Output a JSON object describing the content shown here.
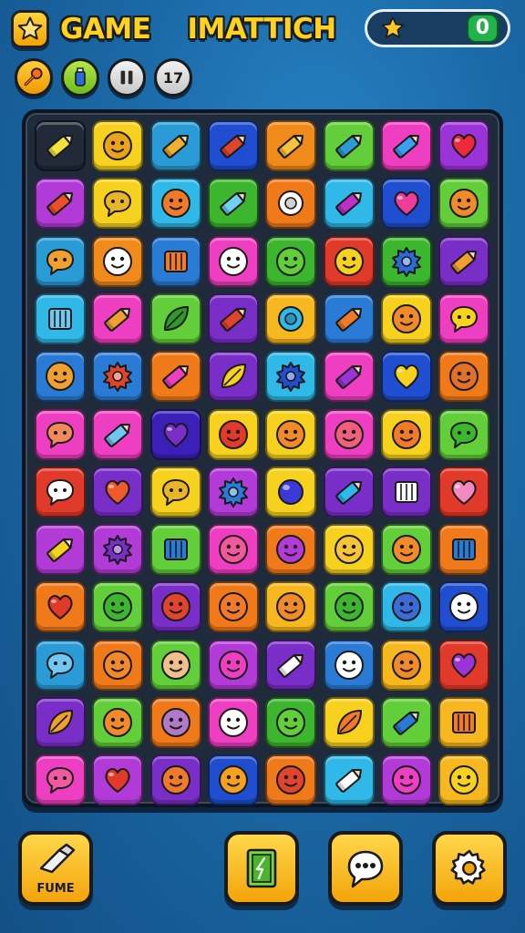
{
  "header": {
    "title_word1": "GAME",
    "title_word2": "IMATTICH",
    "score_value": "0",
    "moves_label": "17"
  },
  "colors": {
    "accent_yellow": "#ffd21f",
    "score_green": "#21b24a",
    "board_bg": "#1f2a3a"
  },
  "toolbar": {
    "buttons": [
      {
        "icon": "key-icon"
      },
      {
        "icon": "bottle-icon"
      },
      {
        "icon": "pause-icon"
      },
      {
        "icon": "moves-counter"
      }
    ]
  },
  "board": {
    "columns": 8,
    "rows": 12,
    "tiles": [
      [
        {
          "c": "#222a3a",
          "i": "pencil",
          "ic": "#f2e23a"
        },
        {
          "c": "#f6d11e",
          "i": "face",
          "ic": "#e9a41c"
        },
        {
          "c": "#2a9bd6",
          "i": "pencil",
          "ic": "#f0b030"
        },
        {
          "c": "#1f4fd0",
          "i": "pencil",
          "ic": "#e0442c"
        },
        {
          "c": "#f08a1a",
          "i": "pencil",
          "ic": "#f6c43a"
        },
        {
          "c": "#62cf3a",
          "i": "pencil",
          "ic": "#2a9bd6"
        },
        {
          "c": "#ee3fc2",
          "i": "pencil",
          "ic": "#3aa0f0"
        },
        {
          "c": "#9a34d8",
          "i": "heart",
          "ic": "#ee2a3a"
        }
      ],
      [
        {
          "c": "#b23bd8",
          "i": "pencil",
          "ic": "#ee4e2a"
        },
        {
          "c": "#f6d11e",
          "i": "bubble",
          "ic": "#e8b42a"
        },
        {
          "c": "#2fb8e8",
          "i": "face",
          "ic": "#f07a2a"
        },
        {
          "c": "#3cb62e",
          "i": "pencil",
          "ic": "#70d0f0"
        },
        {
          "c": "#f07a1a",
          "i": "ring",
          "ic": "#ffffff"
        },
        {
          "c": "#2fb8e8",
          "i": "pencil",
          "ic": "#c030c8"
        },
        {
          "c": "#1f4fd0",
          "i": "heart",
          "ic": "#ee3c9a"
        },
        {
          "c": "#62cf3a",
          "i": "face",
          "ic": "#f08a2a"
        }
      ],
      [
        {
          "c": "#2a9bd6",
          "i": "bubble",
          "ic": "#f0a030"
        },
        {
          "c": "#f08a1a",
          "i": "face",
          "ic": "#ffffff"
        },
        {
          "c": "#2a7bd6",
          "i": "box",
          "ic": "#f07a2a"
        },
        {
          "c": "#ee3fc2",
          "i": "face",
          "ic": "#ffffff"
        },
        {
          "c": "#3cb62e",
          "i": "face",
          "ic": "#62cf3a"
        },
        {
          "c": "#e23a2a",
          "i": "face",
          "ic": "#f6d11e"
        },
        {
          "c": "#3cb62e",
          "i": "gear",
          "ic": "#2a6bd6"
        },
        {
          "c": "#7a2ec8",
          "i": "pencil",
          "ic": "#f0a030"
        }
      ],
      [
        {
          "c": "#2fb8e8",
          "i": "box",
          "ic": "#70c8f0"
        },
        {
          "c": "#ee3fc2",
          "i": "pencil",
          "ic": "#f0a030"
        },
        {
          "c": "#62cf3a",
          "i": "leaf",
          "ic": "#2f9a2a"
        },
        {
          "c": "#7a2ec8",
          "i": "pencil",
          "ic": "#e0442c"
        },
        {
          "c": "#f6b81e",
          "i": "ring",
          "ic": "#2fb8e8"
        },
        {
          "c": "#2a7bd6",
          "i": "pencil",
          "ic": "#f07a2a"
        },
        {
          "c": "#f6d11e",
          "i": "face",
          "ic": "#f08a2a"
        },
        {
          "c": "#ee3fc2",
          "i": "bubble",
          "ic": "#f6d11e"
        }
      ],
      [
        {
          "c": "#2a7bd6",
          "i": "face",
          "ic": "#f0a030"
        },
        {
          "c": "#2a7bd6",
          "i": "gear",
          "ic": "#e0442c"
        },
        {
          "c": "#f07a1a",
          "i": "pencil",
          "ic": "#ee3fc2"
        },
        {
          "c": "#7a2ec8",
          "i": "leaf",
          "ic": "#f6d11e"
        },
        {
          "c": "#2fb8e8",
          "i": "gear",
          "ic": "#1f4fd0"
        },
        {
          "c": "#ee3fc2",
          "i": "pencil",
          "ic": "#9a34d8"
        },
        {
          "c": "#1f4fd0",
          "i": "heart",
          "ic": "#f6d11e"
        },
        {
          "c": "#f07a1a",
          "i": "face",
          "ic": "#e0702a"
        }
      ],
      [
        {
          "c": "#ee3fc2",
          "i": "bubble",
          "ic": "#f08a5a"
        },
        {
          "c": "#ee3fc2",
          "i": "pencil",
          "ic": "#70c8f0"
        },
        {
          "c": "#3a1fb8",
          "i": "heart",
          "ic": "#7a2ec8"
        },
        {
          "c": "#f6d11e",
          "i": "face",
          "ic": "#e23a2a"
        },
        {
          "c": "#f6d11e",
          "i": "face",
          "ic": "#f08a2a"
        },
        {
          "c": "#ee3fc2",
          "i": "face",
          "ic": "#f0607a"
        },
        {
          "c": "#f6d11e",
          "i": "face",
          "ic": "#f07a2a"
        },
        {
          "c": "#62cf3a",
          "i": "bubble",
          "ic": "#3cb62e"
        }
      ],
      [
        {
          "c": "#e23a2a",
          "i": "bubble",
          "ic": "#ffffff"
        },
        {
          "c": "#7a2ec8",
          "i": "heart",
          "ic": "#ee5a2a"
        },
        {
          "c": "#f6d11e",
          "i": "bubble",
          "ic": "#e8b42a"
        },
        {
          "c": "#b23bd8",
          "i": "gear",
          "ic": "#2a7bd6"
        },
        {
          "c": "#f6d11e",
          "i": "ball",
          "ic": "#3a3ad8"
        },
        {
          "c": "#7a2ec8",
          "i": "pencil",
          "ic": "#2fb8e8"
        },
        {
          "c": "#7a2ec8",
          "i": "box",
          "ic": "#ffffff"
        },
        {
          "c": "#e23a2a",
          "i": "heart",
          "ic": "#f08ac0"
        }
      ],
      [
        {
          "c": "#b23bd8",
          "i": "pencil",
          "ic": "#f6d11e"
        },
        {
          "c": "#b23bd8",
          "i": "gear",
          "ic": "#7a2ec8"
        },
        {
          "c": "#62cf3a",
          "i": "box",
          "ic": "#2a7bd6"
        },
        {
          "c": "#ee3fc2",
          "i": "face",
          "ic": "#f05a9a"
        },
        {
          "c": "#f07a1a",
          "i": "face",
          "ic": "#b23bd8"
        },
        {
          "c": "#f6d11e",
          "i": "face",
          "ic": "#f6c43a"
        },
        {
          "c": "#62cf3a",
          "i": "face",
          "ic": "#f08a2a"
        },
        {
          "c": "#f07a1a",
          "i": "box",
          "ic": "#2a7bd6"
        }
      ],
      [
        {
          "c": "#f07a1a",
          "i": "heart",
          "ic": "#e23a2a"
        },
        {
          "c": "#62cf3a",
          "i": "face",
          "ic": "#3cb62e"
        },
        {
          "c": "#7a2ec8",
          "i": "face",
          "ic": "#e0442c"
        },
        {
          "c": "#f07a1a",
          "i": "face",
          "ic": "#f07a2a"
        },
        {
          "c": "#f6b81e",
          "i": "face",
          "ic": "#f08a2a"
        },
        {
          "c": "#62cf3a",
          "i": "face",
          "ic": "#3cb62e"
        },
        {
          "c": "#2fb8e8",
          "i": "face",
          "ic": "#3a6bd6"
        },
        {
          "c": "#1f4fd0",
          "i": "face",
          "ic": "#ffffff"
        }
      ],
      [
        {
          "c": "#2a9bd6",
          "i": "bubble",
          "ic": "#70c8f0"
        },
        {
          "c": "#f07a1a",
          "i": "face",
          "ic": "#f08a2a"
        },
        {
          "c": "#62cf3a",
          "i": "face",
          "ic": "#f0c08a"
        },
        {
          "c": "#b23bd8",
          "i": "face",
          "ic": "#ee3fc2"
        },
        {
          "c": "#7a2ec8",
          "i": "pencil",
          "ic": "#ffffff"
        },
        {
          "c": "#2a7bd6",
          "i": "face",
          "ic": "#ffffff"
        },
        {
          "c": "#f6b81e",
          "i": "face",
          "ic": "#f08a2a"
        },
        {
          "c": "#e23a2a",
          "i": "heart",
          "ic": "#9a34d8"
        }
      ],
      [
        {
          "c": "#7a2ec8",
          "i": "leaf",
          "ic": "#f0a030"
        },
        {
          "c": "#62cf3a",
          "i": "face",
          "ic": "#f08a2a"
        },
        {
          "c": "#f07a1a",
          "i": "face",
          "ic": "#b07ac8"
        },
        {
          "c": "#ee3fc2",
          "i": "face",
          "ic": "#ffffff"
        },
        {
          "c": "#3cb62e",
          "i": "face",
          "ic": "#62cf3a"
        },
        {
          "c": "#f6d11e",
          "i": "leaf",
          "ic": "#f07a2a"
        },
        {
          "c": "#62cf3a",
          "i": "pencil",
          "ic": "#2a7bd6"
        },
        {
          "c": "#f6b81e",
          "i": "box",
          "ic": "#f07a2a"
        }
      ],
      [
        {
          "c": "#ee3fc2",
          "i": "bubble",
          "ic": "#f05aa0"
        },
        {
          "c": "#b23bd8",
          "i": "heart",
          "ic": "#e23a2a"
        },
        {
          "c": "#7a2ec8",
          "i": "face",
          "ic": "#f07a2a"
        },
        {
          "c": "#1f4fd0",
          "i": "face",
          "ic": "#f6a01e"
        },
        {
          "c": "#f07a1a",
          "i": "face",
          "ic": "#e0442c"
        },
        {
          "c": "#2fb8e8",
          "i": "pencil",
          "ic": "#ffffff"
        },
        {
          "c": "#b23bd8",
          "i": "face",
          "ic": "#ee3fc2"
        },
        {
          "c": "#f6b81e",
          "i": "face",
          "ic": "#f6d11e"
        }
      ]
    ]
  },
  "bottom_bar": {
    "left_label": "FUME",
    "buttons": [
      {
        "icon": "hammer-icon"
      },
      {
        "icon": "book-icon"
      },
      {
        "icon": "chat-bubble-icon"
      },
      {
        "icon": "gear-icon"
      }
    ]
  }
}
